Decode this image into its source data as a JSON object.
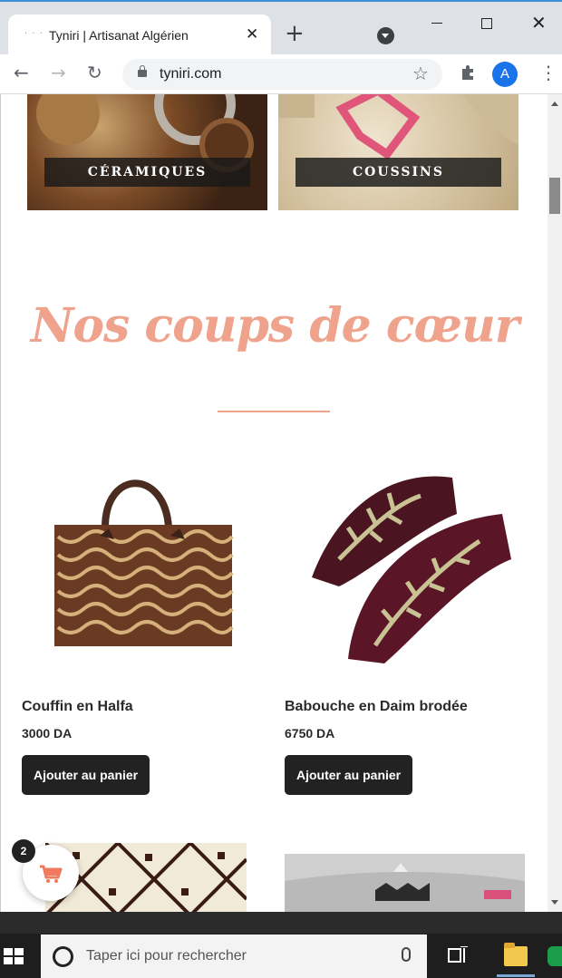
{
  "browser": {
    "tab_title": "Tyniri | Artisanat Algérien",
    "tab_favicon": "· · ·",
    "url": "tyniri.com",
    "avatar_letter": "A"
  },
  "page": {
    "categories": [
      {
        "label": "CÉRAMIQUES"
      },
      {
        "label": "COUSSINS"
      }
    ],
    "section_title": "Nos coups de cœur",
    "products": [
      {
        "name": "Couffin en Halfa",
        "price": "3000 DA",
        "button": "Ajouter au panier"
      },
      {
        "name": "Babouche en Daim brodée",
        "price": "6750 DA",
        "button": "Ajouter au panier"
      }
    ],
    "cart_count": "2"
  },
  "taskbar": {
    "search_placeholder": "Taper ici pour rechercher"
  },
  "colors": {
    "accent": "#f0a38c",
    "button": "#222222",
    "browser_blue": "#1a73e8"
  },
  "icons": [
    "back-arrow-icon",
    "forward-arrow-icon",
    "reload-icon",
    "lock-icon",
    "star-icon",
    "extensions-icon",
    "menu-icon",
    "cart-icon",
    "windows-icon",
    "cortana-icon",
    "mic-icon",
    "task-view-icon",
    "file-explorer-icon"
  ]
}
